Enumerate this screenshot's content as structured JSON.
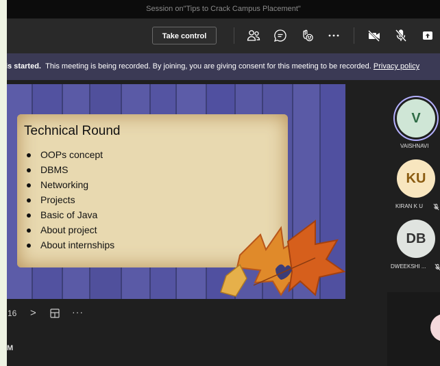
{
  "window": {
    "title": "Session on\"Tips to Crack Campus Placement\""
  },
  "toolbar": {
    "take_control_label": "Take control",
    "icons": [
      "participants-icon",
      "chat-icon",
      "reactions-icon",
      "more-icon",
      "camera-off-icon",
      "mic-off-icon",
      "share-icon"
    ]
  },
  "banner": {
    "prefix": "is started.",
    "message": "This meeting is being recorded. By joining, you are giving consent for this meeting to be recorded.",
    "link": "Privacy policy"
  },
  "slide": {
    "title": "Technical Round",
    "bullets": [
      "OOPs concept",
      "DBMS",
      "Networking",
      "Projects",
      "Basic of Java",
      "About  project",
      "About  internships"
    ]
  },
  "slide_nav": {
    "page": "16",
    "next": ">",
    "more": "···"
  },
  "footer": {
    "text": "M"
  },
  "participants": [
    {
      "initials": "V",
      "name": "VAISHNAVI",
      "muted": false,
      "speaking": true
    },
    {
      "initials": "KU",
      "name": "KIRAN K U",
      "muted": true,
      "speaking": false
    },
    {
      "initials": "DB",
      "name": "DWEEKSHI ...",
      "muted": true,
      "speaking": false
    }
  ],
  "colors": {
    "window_bg": "#1f1f1f",
    "banner_bg": "#3b3a55",
    "avatar_green": "#cfe6d6",
    "avatar_green_text": "#2e6b45",
    "avatar_yellow": "#f8e6bf",
    "avatar_yellow_text": "#8a5b10",
    "avatar_grey": "#e0e4e0",
    "avatar_grey_text": "#333333",
    "speaking_ring": "#b4b0ff"
  }
}
